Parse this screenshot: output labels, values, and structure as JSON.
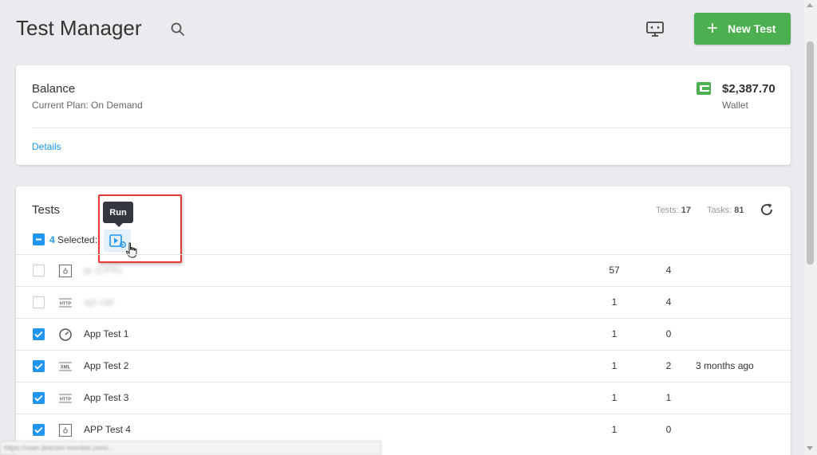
{
  "header": {
    "title": "Test Manager",
    "new_test_label": "New Test"
  },
  "balance": {
    "title": "Balance",
    "plan": "Current Plan: On Demand",
    "amount": "$2,387.70",
    "wallet_label": "Wallet",
    "details_link": "Details"
  },
  "tests": {
    "title": "Tests",
    "tests_label": "Tests:",
    "tests_count": "17",
    "tasks_label": "Tasks:",
    "tasks_count": "81",
    "selected_count": "4",
    "selected_label": "Selected:",
    "tooltip": "Run",
    "rows": [
      {
        "icon": "browser-icon",
        "name": "pr (CPR)",
        "c1": "57",
        "c2": "4",
        "c3": "",
        "checked": false,
        "blurred": true
      },
      {
        "icon": "http-icon",
        "name": "api call",
        "c1": "1",
        "c2": "4",
        "c3": "",
        "checked": false,
        "blurred": true
      },
      {
        "icon": "speedometer-icon",
        "name": "App Test 1",
        "c1": "1",
        "c2": "0",
        "c3": "",
        "checked": true,
        "blurred": false
      },
      {
        "icon": "xml-icon",
        "name": "App Test 2",
        "c1": "1",
        "c2": "2",
        "c3": "3 months ago",
        "checked": true,
        "blurred": false
      },
      {
        "icon": "http-icon",
        "name": "App Test 3",
        "c1": "1",
        "c2": "1",
        "c3": "",
        "checked": true,
        "blurred": false
      },
      {
        "icon": "browser-icon",
        "name": "APP Test 4",
        "c1": "1",
        "c2": "0",
        "c3": "",
        "checked": true,
        "blurred": false
      }
    ]
  },
  "status_bar": {
    "url": "https://user.dotcom-monitor.com/..."
  },
  "colors": {
    "accent_green": "#4caf50",
    "accent_blue": "#2196f3",
    "highlight_red": "#e53935"
  }
}
